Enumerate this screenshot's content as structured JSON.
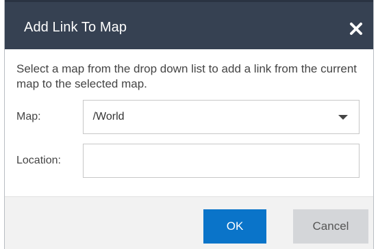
{
  "dialog": {
    "title": "Add Link To Map",
    "close_icon": "close-x-icon",
    "description": "Select a map from the drop down list to add a link from the current map to the selected map.",
    "map_label": "Map:",
    "map_value": "/World",
    "location_label": "Location:",
    "location_value": "",
    "ok_label": "OK",
    "cancel_label": "Cancel"
  },
  "colors": {
    "titlebar": "#364152",
    "ok_button": "#0a74c9",
    "cancel_button": "#d4d6d9",
    "footer": "#f2f2f2"
  }
}
